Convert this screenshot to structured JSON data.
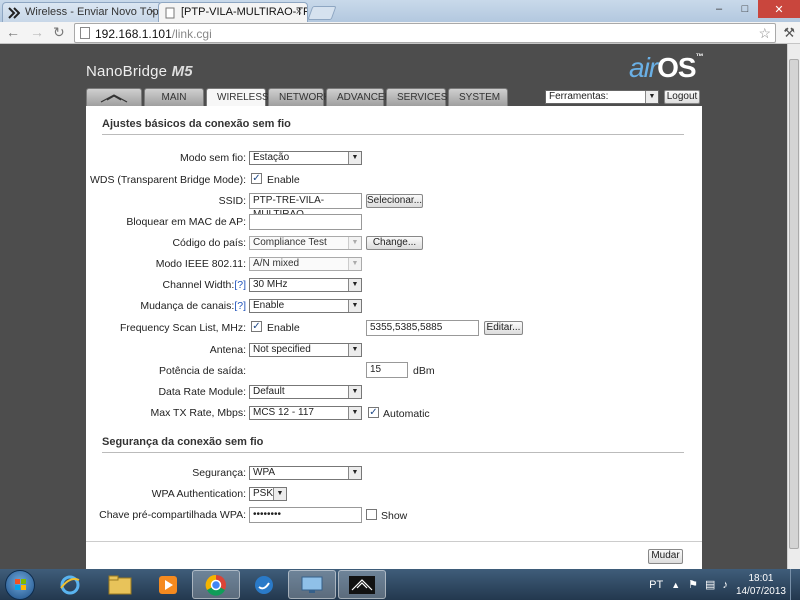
{
  "browser": {
    "tabs": [
      {
        "title": "Wireless - Enviar Novo Tóp",
        "close": "×"
      },
      {
        "title": "[PTP-VILA-MULTIRAO-TR",
        "close": "×"
      }
    ],
    "url_host": "192.168.1.101",
    "url_path": "/link.cgi"
  },
  "header": {
    "brand": "NanoBridge",
    "brand_model": "M5",
    "logo_air": "air",
    "logo_os": "OS",
    "logo_tm": "™",
    "tabs": [
      "MAIN",
      "WIRELESS",
      "NETWORK",
      "ADVANCED",
      "SERVICES",
      "SYSTEM"
    ],
    "active_tab": "WIRELESS",
    "tools_value": "Ferramentas:",
    "logout_label": "Logout"
  },
  "basic": {
    "section_title": "Ajustes básicos da conexão sem fio",
    "wireless_mode": {
      "label": "Modo sem fio:",
      "value": "Estação"
    },
    "wds": {
      "label": "WDS (Transparent Bridge Mode):",
      "checkbox_label": "Enable",
      "checked": true
    },
    "ssid": {
      "label": "SSID:",
      "value": "PTP-TRE-VILA-MULTIRAO",
      "button": "Selecionar..."
    },
    "lock_ap": {
      "label": "Bloquear em MAC de AP:",
      "value": ""
    },
    "country": {
      "label": "Código do país:",
      "value": "Compliance Test",
      "button": "Change..."
    },
    "ieee_mode": {
      "label": "Modo IEEE 802.11:",
      "value": "A/N mixed"
    },
    "channel_width": {
      "label": "Channel Width:",
      "help": "[?]",
      "value": "30 MHz"
    },
    "channel_shift": {
      "label": "Mudança de canais:",
      "help": "[?]",
      "value": "Enable"
    },
    "scan_list": {
      "label": "Frequency Scan List, MHz:",
      "checkbox_label": "Enable",
      "checked": true,
      "value": "5355,5385,5885",
      "button": "Editar..."
    },
    "antenna": {
      "label": "Antena:",
      "value": "Not specified"
    },
    "output_power": {
      "label": "Potência de saída:",
      "value": "15",
      "unit": "dBm"
    },
    "data_rate": {
      "label": "Data Rate Module:",
      "value": "Default"
    },
    "max_tx": {
      "label": "Max TX Rate, Mbps:",
      "value": "MCS 12 - 117",
      "checkbox_label": "Automatic",
      "checked": true
    }
  },
  "security": {
    "section_title": "Segurança da conexão sem fio",
    "security": {
      "label": "Segurança:",
      "value": "WPA"
    },
    "wpa_auth": {
      "label": "WPA Authentication:",
      "value": "PSK"
    },
    "psk": {
      "label": "Chave pré-compartilhada WPA:",
      "value": "••••••••",
      "checkbox_label": "Show",
      "checked": false
    }
  },
  "footer": {
    "change_button": "Mudar"
  },
  "taskbar": {
    "lang": "PT",
    "time": "18:01",
    "date": "14/07/2013"
  }
}
